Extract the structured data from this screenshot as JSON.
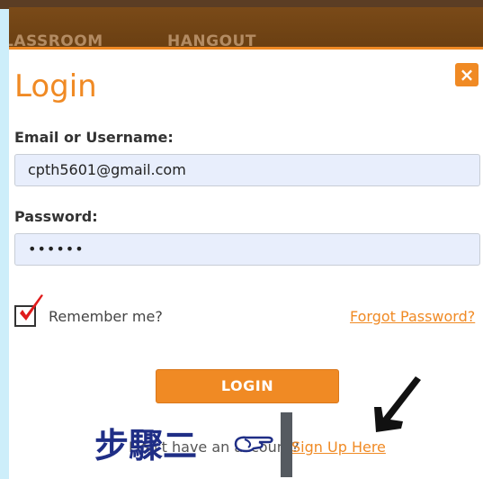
{
  "nav": {
    "items": [
      "LASSROOM",
      "HANGOUT"
    ]
  },
  "modal": {
    "close_icon": "×",
    "title": "Login",
    "email_label": "Email or Username:",
    "email_value": "cpth5601@gmail.com",
    "password_label": "Password:",
    "password_value": "••••••",
    "remember_label": "Remember me?",
    "remember_checked": true,
    "forgot_link": "Forgot Password?",
    "login_button": "LOGIN",
    "signup_prompt": "Don't have an account?",
    "signup_link": "Sign Up Here"
  },
  "annotations": {
    "step_text": "步驟二",
    "icons": [
      "pointing-hand-icon",
      "arrow-down-left-icon"
    ]
  },
  "colors": {
    "accent": "#f08a24",
    "nav_bg": "#7a4a18",
    "field_bg": "#e8eefc",
    "annotation_text": "#1f2e86",
    "checkmark": "#e01b1b"
  }
}
